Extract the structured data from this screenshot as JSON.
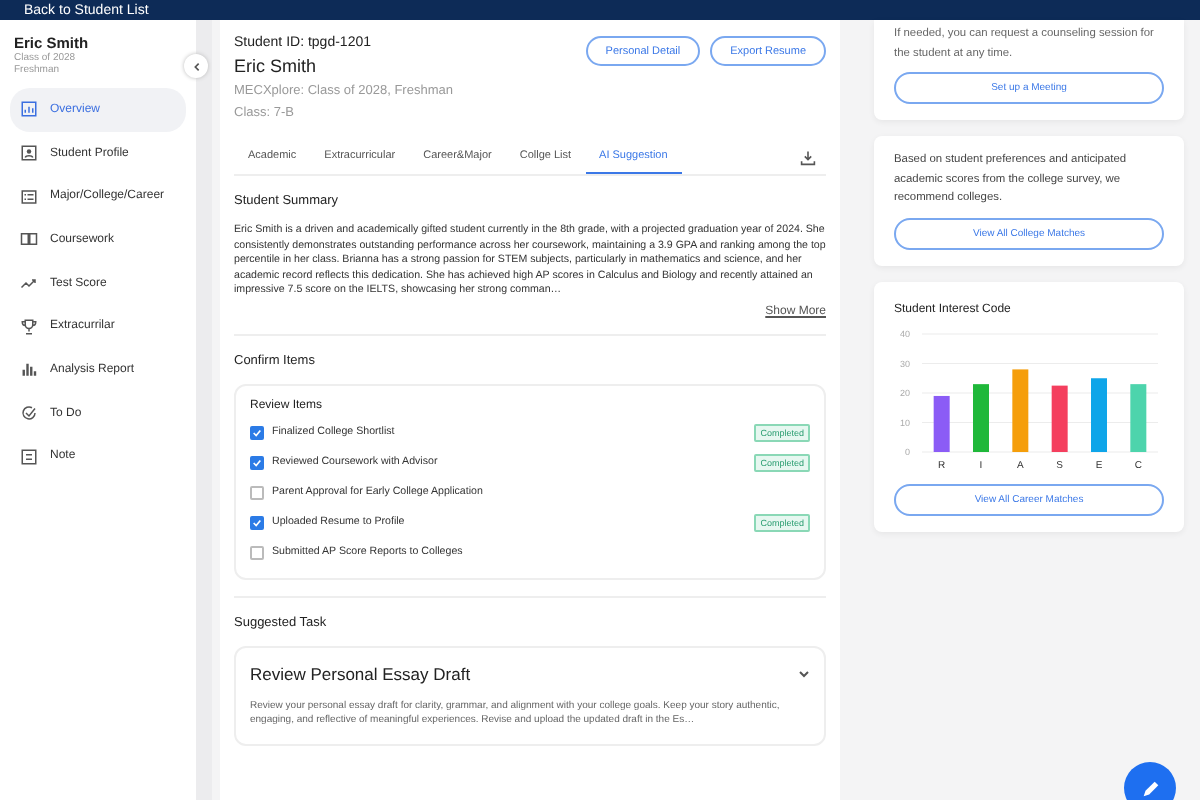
{
  "top_bar": {
    "back_link": "Back to Student List"
  },
  "sidebar": {
    "student_name": "Eric Smith",
    "class_line": "Class of 2028",
    "grade": "Freshman",
    "items": [
      {
        "label": "Overview",
        "selected": true
      },
      {
        "label": "Student Profile",
        "selected": false
      },
      {
        "label": "Major/College/Career",
        "selected": false
      },
      {
        "label": "Coursework",
        "selected": false
      },
      {
        "label": "Test Score",
        "selected": false
      },
      {
        "label": "Extracurrilar",
        "selected": false
      },
      {
        "label": "Analysis Report",
        "selected": false
      },
      {
        "label": "To Do",
        "selected": false
      },
      {
        "label": "Note",
        "selected": false
      }
    ]
  },
  "student": {
    "id_line": "Student ID: tpgd-1201",
    "name": "Eric Smith",
    "program": "MECXplore: Class of 2028, Freshman",
    "class": "Class: 7-B",
    "buttons": [
      "Personal Detail",
      "Export Resume"
    ]
  },
  "tabs": [
    {
      "label": "Academic",
      "selected": false
    },
    {
      "label": "Extracurricular",
      "selected": false
    },
    {
      "label": "Career&Major",
      "selected": false
    },
    {
      "label": "Collge List",
      "selected": false
    },
    {
      "label": "AI Suggestion",
      "selected": true
    }
  ],
  "summary": {
    "title": "Student Summary",
    "text": "Eric Smith is a driven and academically gifted student currently in the 8th grade, with a projected graduation year of 2024. She consistently demonstrates outstanding performance across her coursework, maintaining a 3.9 GPA and ranking among the top percentile in her class. Brianna has a strong passion for STEM subjects, particularly in mathematics and science, and her academic record reflects this dedication. She has achieved high AP scores in Calculus and Biology and recently attained an impressive 7.5 score on the IELTS, showcasing her strong comman…",
    "more_link": "Show More"
  },
  "confirm": {
    "title": "Confirm Items",
    "box_title": "Review Items",
    "items": [
      {
        "label": "Finalized College Shortlist",
        "checked": true,
        "badge": "Completed"
      },
      {
        "label": "Reviewed Coursework with Advisor",
        "checked": true,
        "badge": "Completed"
      },
      {
        "label": "Parent Approval for Early College Application",
        "checked": false
      },
      {
        "label": "Uploaded Resume to Profile",
        "checked": true,
        "badge": "Completed"
      },
      {
        "label": "Submitted AP Score Reports to Colleges",
        "checked": false
      }
    ]
  },
  "suggested": {
    "title": "Suggested Task",
    "task_title": "Review Personal Essay Draft",
    "task_text": "Review your personal essay draft for clarity, grammar, and alignment with your college goals. Keep your story authentic, engaging, and reflective of meaningful experiences. Revise and upload the updated draft in the Es…"
  },
  "meeting_card": {
    "text": "If needed, you can request a counseling session for the student at any time.",
    "button": "Set up a Meeting"
  },
  "college_card": {
    "text": "Based on student preferences and anticipated academic scores from the college survey, we recommend colleges.",
    "button": "View All College Matches"
  },
  "interest_card": {
    "title": "Student Interest Code",
    "button": "View All Career Matches",
    "chart_data": {
      "type": "bar",
      "categories": [
        "R",
        "I",
        "A",
        "S",
        "E",
        "C"
      ],
      "values": [
        19,
        23,
        28,
        22.5,
        25,
        23
      ],
      "grid": true,
      "colors": [
        "#8b5cf6",
        "#1fb83a",
        "#f59e0b",
        "#f43f5e",
        "#0ea5e9",
        "#4dd4ac"
      ],
      "ylim": [
        0,
        40
      ],
      "yticks": [
        0,
        10,
        20,
        30,
        40
      ]
    }
  }
}
